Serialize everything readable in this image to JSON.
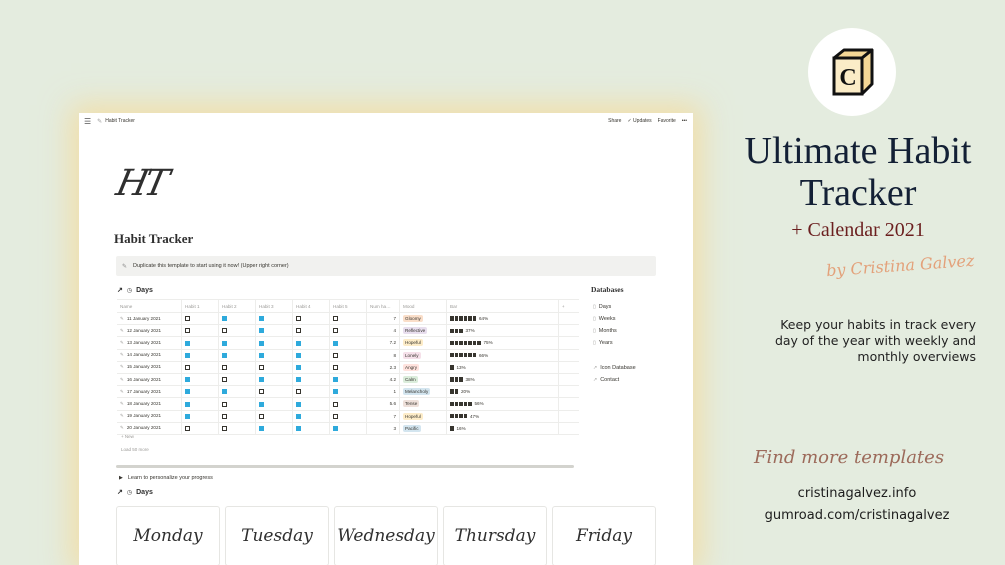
{
  "window": {
    "breadcrumb": "Habit Tracker",
    "share": "Share",
    "updates": "Updates",
    "favorite": "Favorite",
    "more": "•••"
  },
  "page": {
    "logo_text": "HT",
    "title": "Habit Tracker",
    "callout": "Duplicate this template to start using it now! (Upper right corner)",
    "section_days": "Days",
    "toggle_text": "Learn to personalize your progress",
    "section_days2": "Days"
  },
  "table": {
    "headers": [
      "Name",
      "Habit 1",
      "Habit 2",
      "Habit 3",
      "Habit 4",
      "Habit 5",
      "Num ha…",
      "Mood",
      "Bar",
      "+"
    ],
    "rows": [
      {
        "name": "11 January 2021",
        "h": [
          false,
          true,
          true,
          false,
          false
        ],
        "num": "7",
        "mood": "Gloomy",
        "mood_color": "#fadec9",
        "blocks": 6,
        "pct": "64%"
      },
      {
        "name": "12 January 2021",
        "h": [
          false,
          false,
          true,
          false,
          false
        ],
        "num": "4",
        "mood": "Reflective",
        "mood_color": "#e8deee",
        "blocks": 3,
        "pct": "37%"
      },
      {
        "name": "13 January 2021",
        "h": [
          true,
          true,
          true,
          true,
          true
        ],
        "num": "7.2",
        "mood": "Hopeful",
        "mood_color": "#fdecc8",
        "blocks": 7,
        "pct": "75%"
      },
      {
        "name": "14 January 2021",
        "h": [
          true,
          true,
          true,
          true,
          false
        ],
        "num": "8",
        "mood": "Lonely",
        "mood_color": "#f5e0e9",
        "blocks": 6,
        "pct": "66%"
      },
      {
        "name": "15 January 2021",
        "h": [
          false,
          false,
          false,
          true,
          false
        ],
        "num": "2.3",
        "mood": "Angry",
        "mood_color": "#ffe2dd",
        "blocks": 1,
        "pct": "13%"
      },
      {
        "name": "16 January 2021",
        "h": [
          true,
          false,
          true,
          true,
          true
        ],
        "num": "4.2",
        "mood": "Calm",
        "mood_color": "#dbeddb",
        "blocks": 3,
        "pct": "38%"
      },
      {
        "name": "17 January 2021",
        "h": [
          true,
          true,
          false,
          false,
          true
        ],
        "num": "1",
        "mood": "Melancholy",
        "mood_color": "#d3e5ef",
        "blocks": 2,
        "pct": "20%"
      },
      {
        "name": "18 January 2021",
        "h": [
          true,
          false,
          true,
          true,
          false
        ],
        "num": "5.6",
        "mood": "Tense",
        "mood_color": "#eee0da",
        "blocks": 5,
        "pct": "56%"
      },
      {
        "name": "19 January 2021",
        "h": [
          true,
          false,
          false,
          true,
          false
        ],
        "num": "7",
        "mood": "Hopeful",
        "mood_color": "#fdecc8",
        "blocks": 4,
        "pct": "47%"
      },
      {
        "name": "20 January 2021",
        "h": [
          false,
          false,
          true,
          true,
          true
        ],
        "num": "3",
        "mood": "Pacific",
        "mood_color": "#d3e5ef",
        "blocks": 1,
        "pct": "16%"
      }
    ],
    "new_label": "+ New",
    "load_more": "Load 50 more"
  },
  "databases": {
    "title": "Databases",
    "items": [
      "Days",
      "Weeks",
      "Months",
      "Years"
    ],
    "links": [
      "Icon Database",
      "Contact"
    ]
  },
  "day_cards": [
    "Monday",
    "Tuesday",
    "Wednesday",
    "Thursday",
    "Friday"
  ],
  "promo": {
    "logo_letter": "C",
    "title": "Ultimate Habit Tracker",
    "subtitle": "+ Calendar 2021",
    "byline": "by Cristina Galvez",
    "tagline": "Keep your habits in track every day of the year with weekly and monthly overviews",
    "find_more": "Find more templates",
    "link1": "cristinagalvez.info",
    "link2": "gumroad.com/cristinagalvez"
  },
  "colors": {
    "background": "#e4ecdf",
    "checked": "#2eaadc",
    "title_navy": "#132035",
    "subtitle_red": "#6b1f1f",
    "accent_peach": "#e3a17a"
  }
}
